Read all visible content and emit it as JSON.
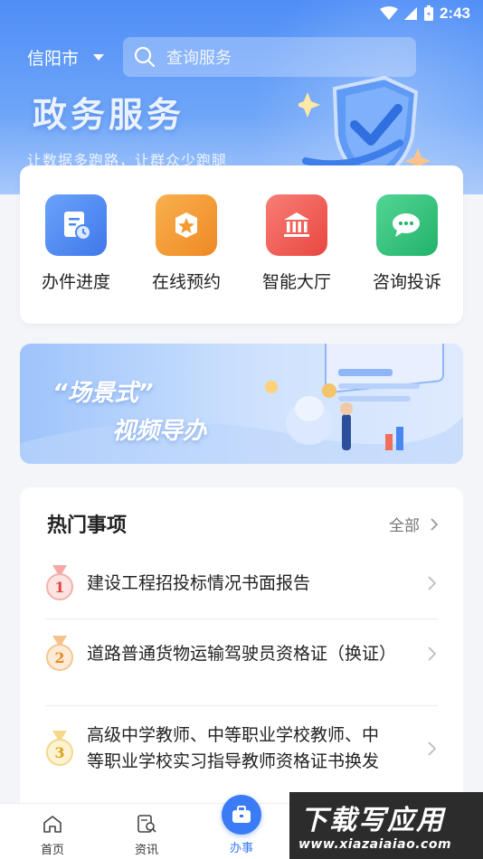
{
  "status_bar": {
    "time": "2:43"
  },
  "header": {
    "city": "信阳市",
    "search_placeholder": "查询服务",
    "hero_title": "政务服务",
    "hero_subtitle": "让数据多跑路，让群众少跑腿"
  },
  "services": [
    {
      "label": "办件进度",
      "icon": "document-clock-icon",
      "color": "#4a86f0"
    },
    {
      "label": "在线预约",
      "icon": "star-badge-icon",
      "color": "#f39a32"
    },
    {
      "label": "智能大厅",
      "icon": "government-hall-icon",
      "color": "#f05a52"
    },
    {
      "label": "咨询投诉",
      "icon": "chat-bubbles-icon",
      "color": "#2fc17a"
    }
  ],
  "banner": {
    "line1": "“场景式”",
    "line2": "视频导办"
  },
  "hot": {
    "title": "热门事项",
    "all_label": "全部",
    "items": [
      {
        "rank": "1",
        "text": "建设工程招投标情况书面报告"
      },
      {
        "rank": "2",
        "text": "道路普通货物运输驾驶员资格证（换证）"
      },
      {
        "rank": "3",
        "text": "高级中学教师、中等职业学校教师、中等职业学校实习指导教师资格证书换发"
      }
    ]
  },
  "bottom_nav": {
    "home": "首页",
    "news": "资讯",
    "tasks": "办事"
  },
  "watermark": {
    "big": "下载写应用",
    "small": "www.xiazaiaiao.com"
  }
}
